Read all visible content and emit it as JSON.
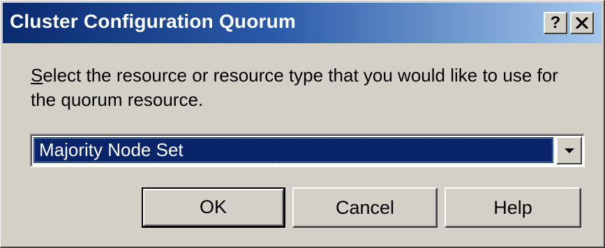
{
  "window": {
    "title": "Cluster Configuration Quorum",
    "help_button": "?",
    "close_button": "✕"
  },
  "prompt": {
    "accelerator": "S",
    "text_rest": "elect the resource or resource type that you would like to use for the quorum resource."
  },
  "quorum_select": {
    "selected_value": "Majority Node Set",
    "arrow_icon": "chevron-down-icon"
  },
  "buttons": {
    "ok_label": "OK",
    "cancel_label": "Cancel",
    "help_label": "Help"
  },
  "colors": {
    "titlebar_start": "#0a2a6e",
    "titlebar_end": "#a6c8ec",
    "selection": "#0a246a",
    "face": "#d4d0c8"
  }
}
